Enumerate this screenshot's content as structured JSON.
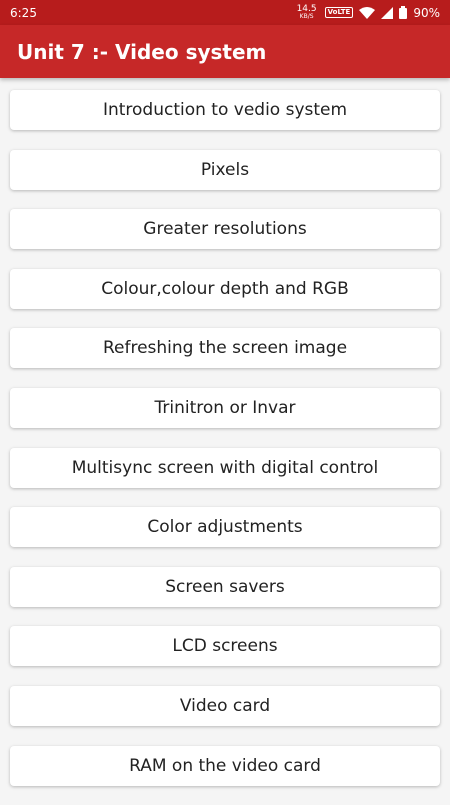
{
  "status_bar": {
    "time": "6:25",
    "speed_value": "14.5",
    "speed_unit": "KB/S",
    "volte": "VoLTE",
    "battery": "90%"
  },
  "app_bar": {
    "title": "Unit 7 :- Video system"
  },
  "topics": [
    {
      "label": "Introduction to vedio system"
    },
    {
      "label": "Pixels"
    },
    {
      "label": "Greater resolutions"
    },
    {
      "label": "Colour,colour depth and RGB"
    },
    {
      "label": "Refreshing the screen image"
    },
    {
      "label": "Trinitron or Invar"
    },
    {
      "label": "Multisync screen with digital control"
    },
    {
      "label": "Color adjustments"
    },
    {
      "label": "Screen savers"
    },
    {
      "label": "LCD screens"
    },
    {
      "label": "Video card"
    },
    {
      "label": "RAM on the video card"
    }
  ],
  "colors": {
    "status_bar": "#b71c1c",
    "app_bar": "#c62828",
    "background": "#f5f5f5",
    "card": "#ffffff"
  },
  "icons": {
    "wifi": "wifi-icon",
    "signal": "signal-icon",
    "battery": "battery-icon"
  }
}
